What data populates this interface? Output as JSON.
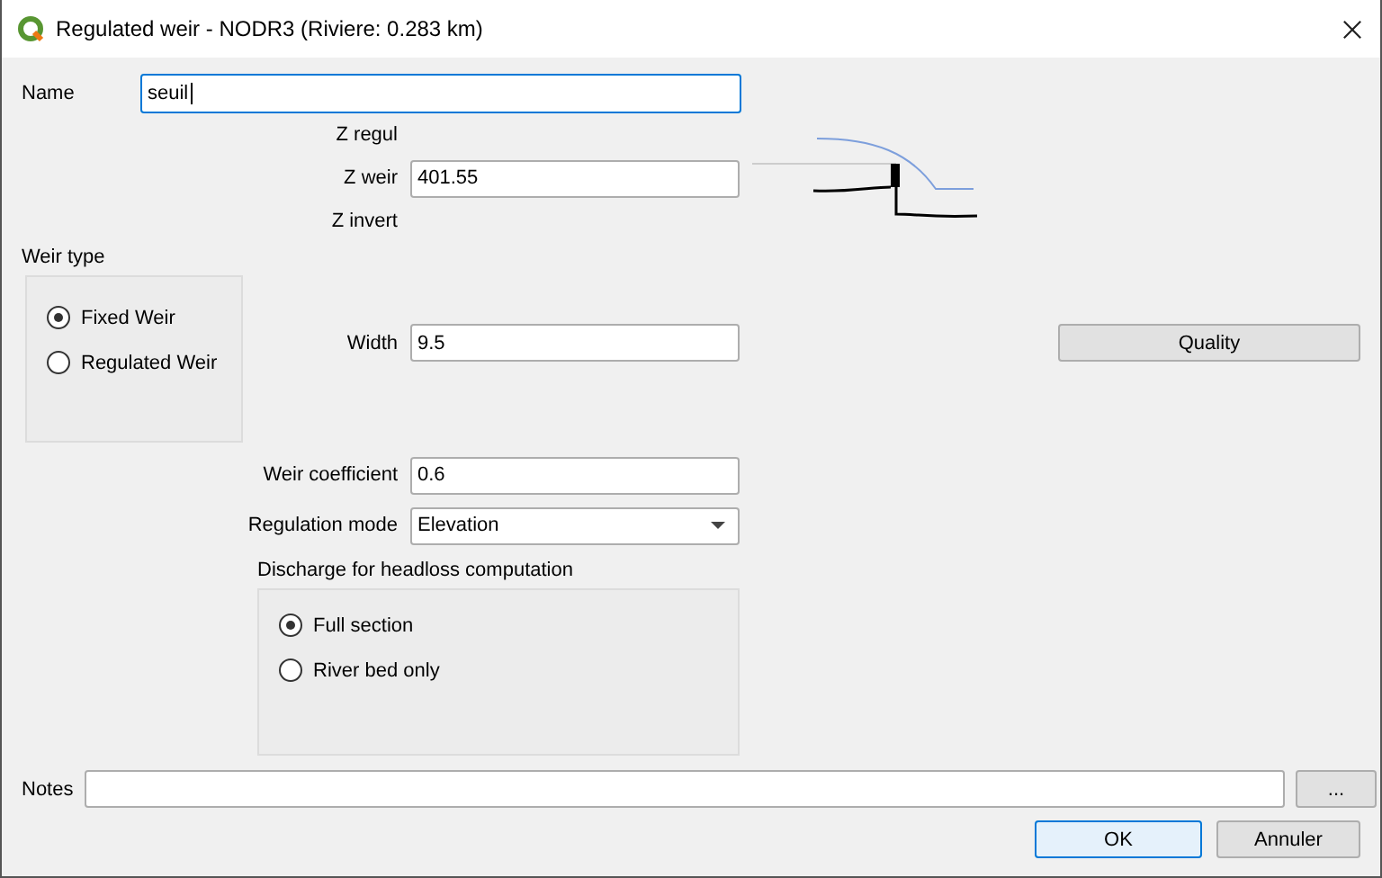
{
  "window": {
    "title": "Regulated weir - NODR3 (Riviere: 0.283 km)"
  },
  "name": {
    "label": "Name",
    "value": "seuil"
  },
  "levels": [
    {
      "label": "Z regul",
      "kind": "label"
    },
    {
      "label": "Z weir",
      "kind": "field",
      "value": "401.55"
    },
    {
      "label": "Z invert",
      "kind": "label"
    }
  ],
  "weir_type": {
    "title": "Weir type",
    "options": [
      {
        "label": "Fixed Weir",
        "selected": true
      },
      {
        "label": "Regulated Weir",
        "selected": false
      }
    ]
  },
  "width": {
    "label": "Width",
    "value": "9.5"
  },
  "quality_button": "Quality",
  "weir_coefficient": {
    "label": "Weir coefficient",
    "value": "0.6"
  },
  "regulation_mode": {
    "label": "Regulation mode",
    "value": "Elevation"
  },
  "discharge": {
    "title": "Discharge for headloss computation",
    "options": [
      {
        "label": "Full section",
        "selected": true
      },
      {
        "label": "River bed only",
        "selected": false
      }
    ]
  },
  "notes": {
    "label": "Notes",
    "browse_button": "..."
  },
  "buttons": [
    "OK",
    "Annuler"
  ]
}
